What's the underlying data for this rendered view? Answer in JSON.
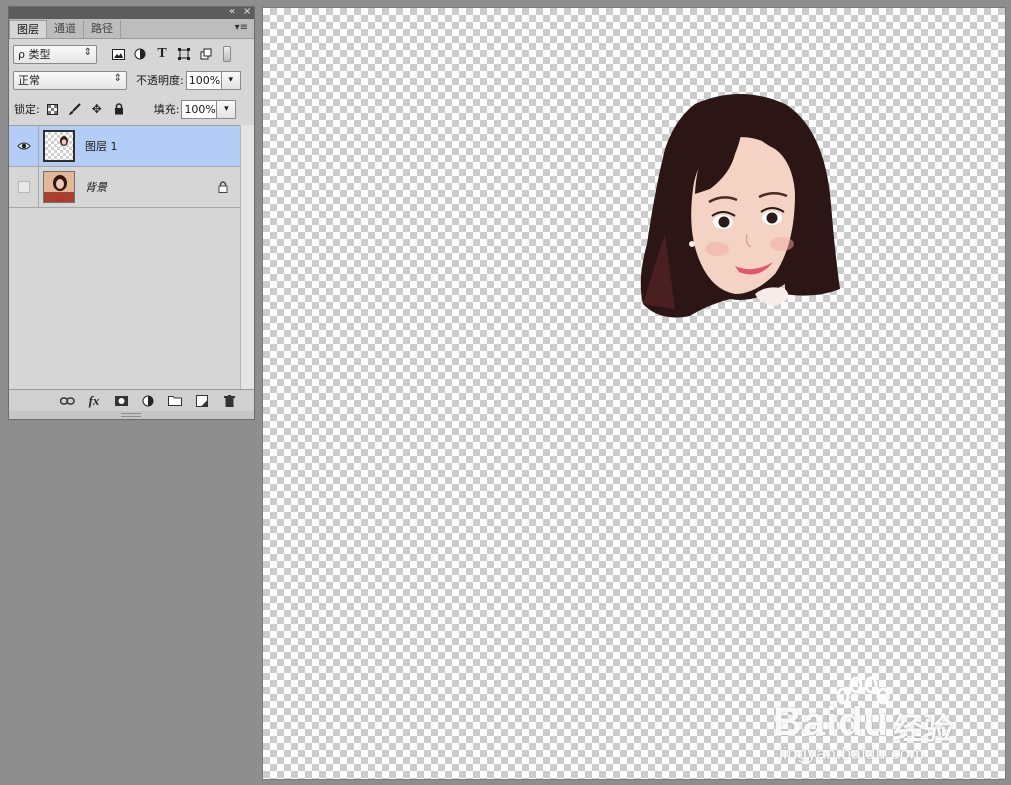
{
  "panel": {
    "tabs": [
      {
        "label": "图层",
        "active": true
      },
      {
        "label": "通道",
        "active": false
      },
      {
        "label": "路径",
        "active": false
      }
    ],
    "filter": {
      "label": "ρ 类型"
    },
    "blend_mode": {
      "value": "正常"
    },
    "opacity": {
      "label": "不透明度:",
      "value": "100%"
    },
    "lock": {
      "label": "锁定:"
    },
    "fill": {
      "label": "填充:",
      "value": "100%"
    },
    "layers": [
      {
        "name": "图层 1",
        "selected": true,
        "visible": true,
        "thumb": "transparent-with-head"
      },
      {
        "name": "背景",
        "selected": false,
        "visible": false,
        "locked": true,
        "thumb": "photo"
      }
    ],
    "bottom_icons": [
      "link-icon",
      "fx-icon",
      "mask-icon",
      "adjustment-icon",
      "folder-icon",
      "new-layer-icon",
      "trash-icon"
    ],
    "fx_label": "fx"
  },
  "canvas": {
    "background": "transparency-checkerboard"
  },
  "watermark": {
    "brand": "Bai",
    "brand_suffix": "du",
    "brand_cn": "经验",
    "url": "jingyan.baidu.com"
  },
  "colors": {
    "selected_layer": "#b3cdf7",
    "panel_bg": "#d6d6d6",
    "workspace_bg": "#8e8e8e"
  }
}
